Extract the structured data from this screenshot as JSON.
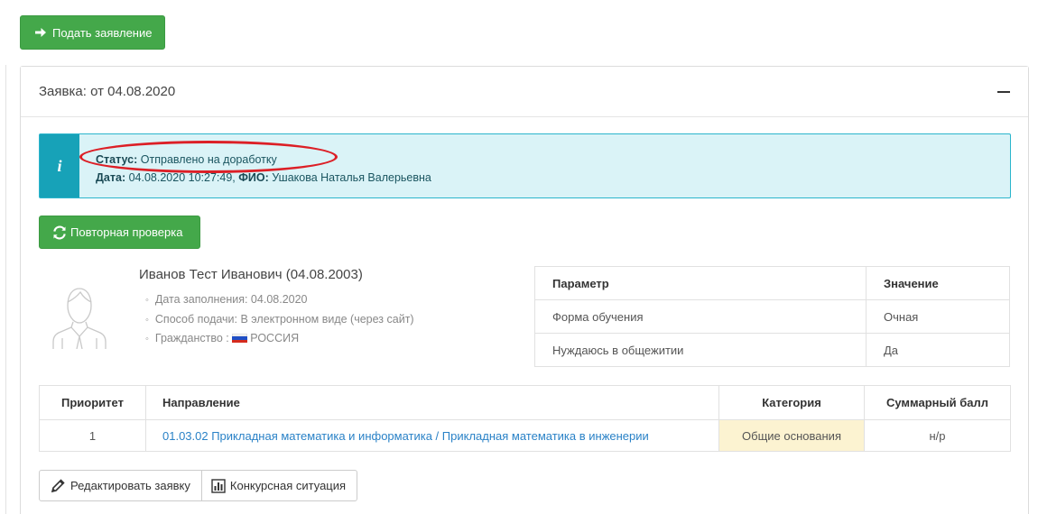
{
  "toolbar": {
    "submit_label": "Подать заявление"
  },
  "application": {
    "title": "Заявка: от 04.08.2020",
    "status_label": "Статус",
    "status_value": "Отправлено на доработку",
    "date_label": "Дата",
    "date_value": "04.08.2020 10:27:49",
    "fio_label": "ФИО",
    "fio_value": "Ушакова Наталья Валерьевна",
    "recheck_label": "Повторная проверка"
  },
  "person": {
    "name": "Иванов Тест Иванович (04.08.2003)",
    "info": [
      "Дата заполнения: 04.08.2020",
      "Способ подачи: В электронном виде (через сайт)",
      "Гражданство :"
    ],
    "citizenship": "РОССИЯ"
  },
  "params": {
    "headers": [
      "Параметр",
      "Значение"
    ],
    "rows": [
      [
        "Форма обучения",
        "Очная"
      ],
      [
        "Нуждаюсь в общежитии",
        "Да"
      ]
    ]
  },
  "directions": {
    "headers": [
      "Приоритет",
      "Направление",
      "Категория",
      "Суммарный балл"
    ],
    "rows": [
      {
        "priority": "1",
        "direction": "01.03.02 Прикладная математика и информатика / Прикладная математика в инженерии",
        "category": "Общие основания",
        "score": "н/р"
      }
    ]
  },
  "actions": {
    "edit_label": "Редактировать заявку",
    "competition_label": "Конкурсная ситуация"
  },
  "colors": {
    "success": "#44a84a",
    "info": "#17a2b8",
    "info_bg": "#daf3f7",
    "highlight_ring": "#dc1f26",
    "link": "#2a82c7",
    "category_bg": "#fcf3d1"
  },
  "icons": [
    "arrow-right-icon",
    "collapse-minus-icon",
    "info-icon",
    "refresh-icon",
    "avatar-icon",
    "russia-flag-icon",
    "pencil-icon",
    "bar-chart-icon"
  ]
}
